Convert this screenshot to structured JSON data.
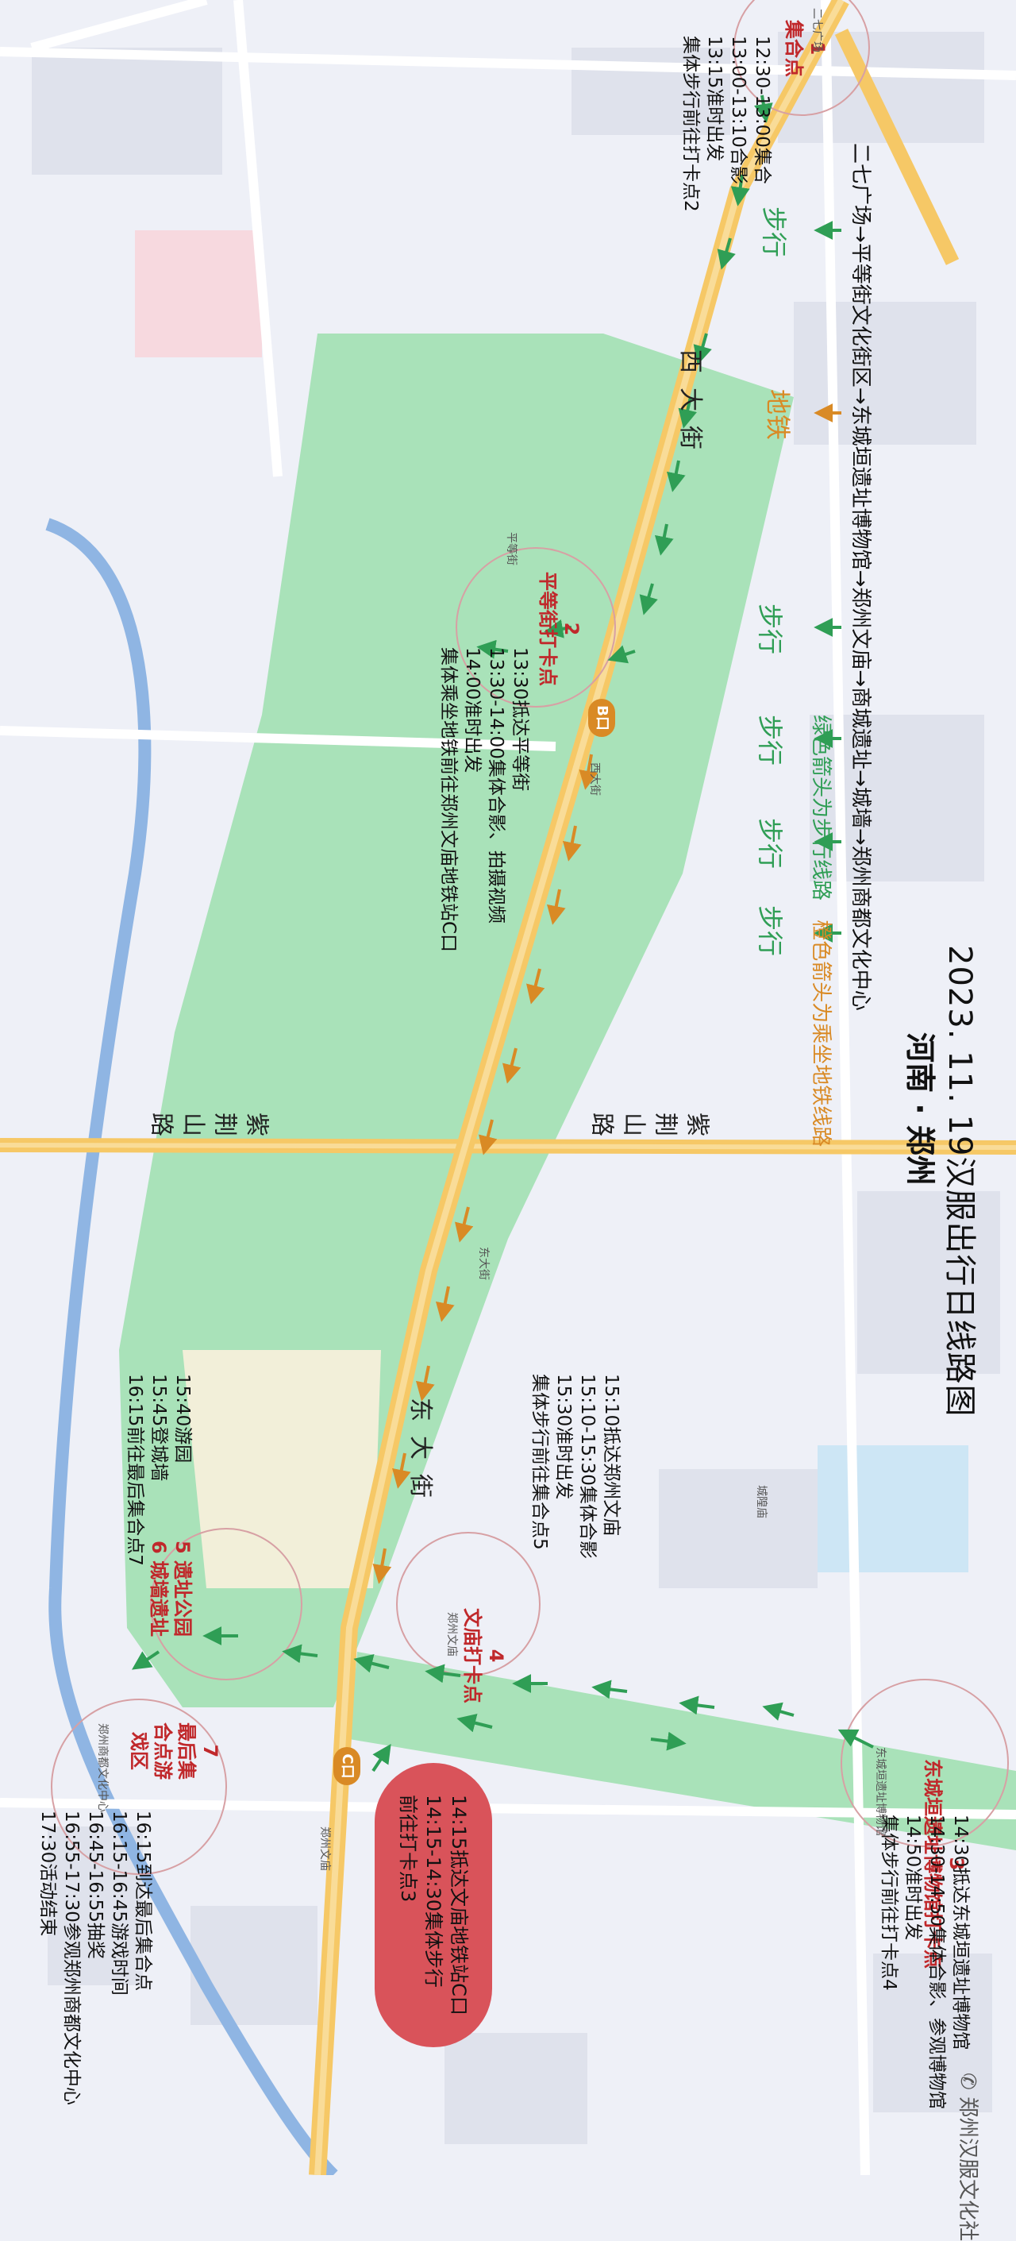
{
  "header": {
    "title": "2023. 11. 19汉服出行日线路图",
    "subtitle": "河南 · 郑州",
    "route": "二七广场→平等街文化街区→东城垣遗址博物馆→郑州文庙→商城遗址→城墙→郑州商都文化中心",
    "legend_walk": "绿色箭头为步行线路",
    "legend_metro": "橙色箭头为乘坐地铁线路"
  },
  "modes": {
    "walk": "步行",
    "metro": "地铁"
  },
  "roads": {
    "xidajie": "西大街",
    "dongdajie": "东大街",
    "zijingshan": "紫荆山路"
  },
  "checkpoints": [
    {
      "num": "1",
      "name": "集合点",
      "lines": [
        "12:30-13:00集合",
        "13:00-13:10合影",
        "13:15准时出发",
        "集体步行前往打卡点2"
      ]
    },
    {
      "num": "2",
      "name": "平等街打卡点",
      "lines": [
        "13:30抵达平等街",
        "13:30-14:00集体合影、拍摄视频",
        "14:00准时出发",
        "集体乘坐地铁前往郑州文庙地铁站C口"
      ]
    },
    {
      "num": "3",
      "name": "东城垣遗址博物馆打卡点",
      "lines": [
        "14:30抵达东城垣遗址博物馆",
        "14:30-14:50集体合影、参观博物馆",
        "14:50准时出发",
        "集体步行前往打卡点4"
      ]
    },
    {
      "num": "4",
      "name": "文庙打卡点",
      "lines": [
        "15:10抵达郑州文庙",
        "15:10-15:30集体合影",
        "15:30准时出发",
        "集体步行前往集合点5"
      ]
    },
    {
      "num": "5",
      "name": "遗址公园",
      "lines": [
        "15:40游园",
        "15:45登城墙",
        "16:15前往最后集合点7"
      ]
    },
    {
      "num": "6",
      "name": "城墙遗址",
      "lines": []
    },
    {
      "num": "7",
      "name": "最后集合点游戏区",
      "lines": [
        "16:15到达最后集合点",
        "16:15-16:45游戏时间",
        "16:45-16:55抽奖",
        "16:55-17:30参观郑州商都文化中心",
        "17:30活动结束"
      ]
    }
  ],
  "gates": {
    "b": "B口",
    "c": "C口"
  },
  "bubble": {
    "lines": [
      "14:15抵达文庙地铁站C口",
      "14:15-14:30集体步行",
      "前往打卡点3"
    ]
  },
  "pois": {
    "erqi_station": "二七广场",
    "pingdengjie": "平等街",
    "xidajie_station": "西大街",
    "dongdajie_station": "东大街",
    "wenmiao": "郑州文庙",
    "wenmiao_station": "郑州文庙",
    "chenghuang": "城隍庙",
    "museum": "东城垣遗址博物馆",
    "shangdu": "郑州商都文化中心"
  },
  "footer": {
    "logo": "郑州汉服文化社"
  },
  "colors": {
    "walk_arrow": "#2f9e55",
    "metro_arrow": "#d98a25",
    "checkpoint_text": "#c0282b",
    "park_green": "#a9e2b9",
    "road_yellow": "#f6c866",
    "river_blue": "#8fb5e3",
    "bubble": "#d9535a"
  }
}
